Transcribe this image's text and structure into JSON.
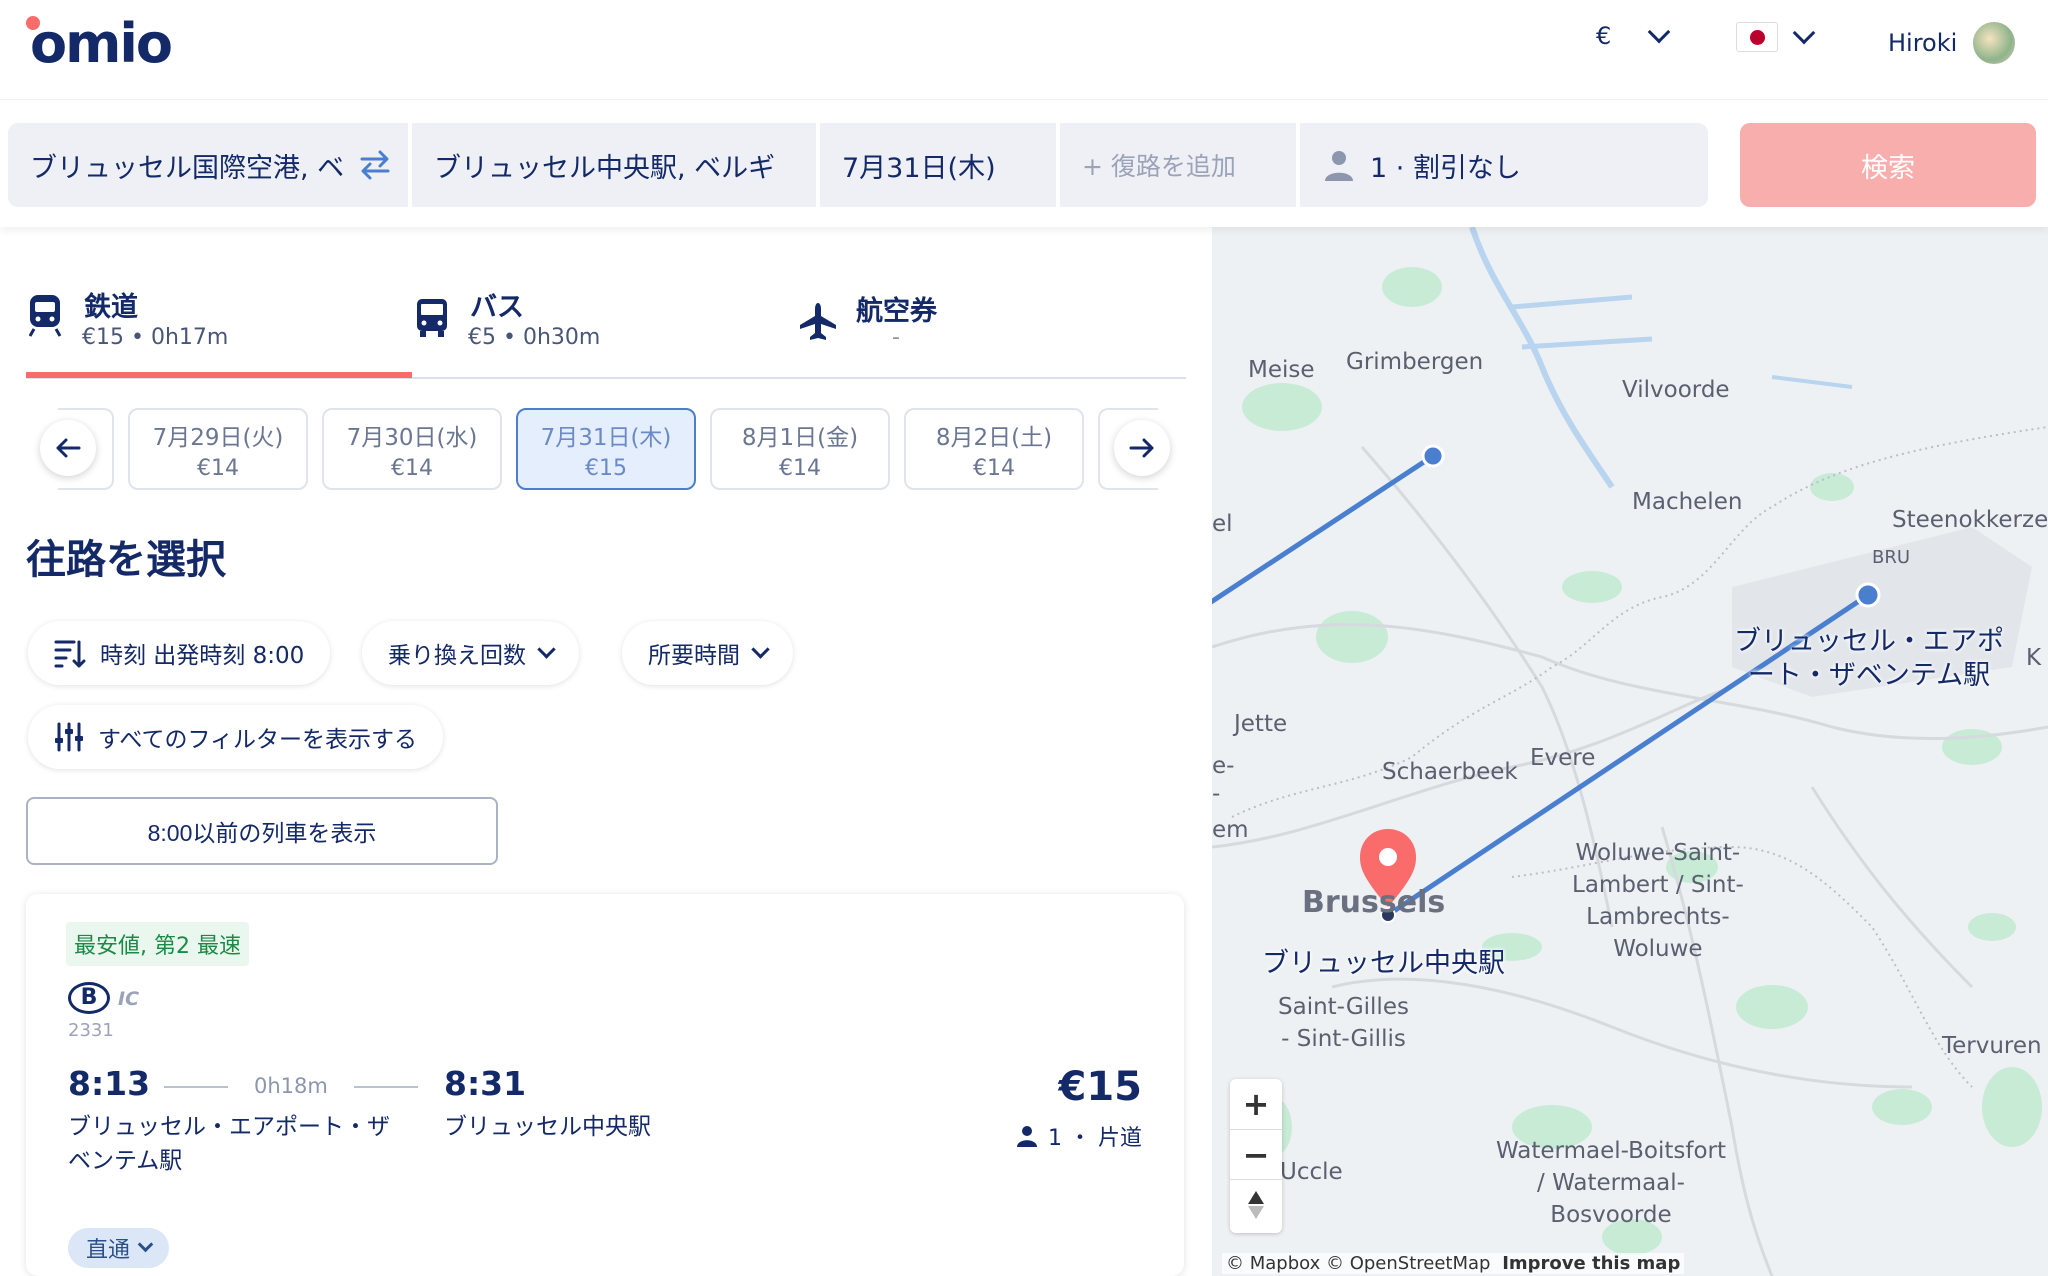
{
  "header": {
    "logo": "omio",
    "currency": "€",
    "user_name": "Hiroki"
  },
  "search": {
    "origin": "ブリュッセル国際空港, ベ",
    "destination": "ブリュッセル中央駅, ベルギ",
    "departure_date": "7月31日(木)",
    "return_placeholder": "+ 復路を追加",
    "passengers": "1 · 割引なし",
    "search_label": "検索"
  },
  "tabs": [
    {
      "title": "鉄道",
      "sub": "€15 • 0h17m"
    },
    {
      "title": "バス",
      "sub": "€5 • 0h30m"
    },
    {
      "title": "航空券",
      "sub": "-"
    }
  ],
  "dates": [
    {
      "date": "7月29日(火)",
      "price": "€14"
    },
    {
      "date": "7月30日(水)",
      "price": "€14"
    },
    {
      "date": "7月31日(木)",
      "price": "€15"
    },
    {
      "date": "8月1日(金)",
      "price": "€14"
    },
    {
      "date": "8月2日(土)",
      "price": "€14"
    }
  ],
  "section_title": "往路を選択",
  "filters": {
    "sort": "時刻 出発時刻 8:00",
    "transfers": "乗り換え回数",
    "duration": "所要時間",
    "all_filters": "すべてのフィルターを表示する",
    "earlier": "8:00以前の列車を表示"
  },
  "result": {
    "badge": "最安値, 第2 最速",
    "operator_logo": "B",
    "train_type": "IC",
    "train_number": "2331",
    "dep_time": "8:13",
    "duration": "0h18m",
    "arr_time": "8:31",
    "dep_station": "ブリュッセル・エアポート・ザベンテム駅",
    "arr_station": "ブリュッセル中央駅",
    "price": "€15",
    "pax": "1 ・ 片道",
    "direct": "直通"
  },
  "map": {
    "labels": {
      "meise": "Meise",
      "grimbergen": "Grimbergen",
      "vilvoorde": "Vilvoorde",
      "machelen": "Machelen",
      "steenokkerzeel": "Steenokkerze",
      "bru": "BRU",
      "el": "el",
      "jette": "Jette",
      "schaerbeek": "Schaerbeek",
      "evere": "Evere",
      "brussels": "Brussels",
      "woluwe": "Woluwe-Saint-\nLambert / Sint-\nLambrechts-\nWoluwe",
      "saint_gilles": "Saint-Gilles\n- Sint-Gillis",
      "tervuren": "Tervuren",
      "uccle": "Uccle",
      "watermael": "Watermael-Boitsfort\n/ Watermaal-\nBosvoorde",
      "airport_station": "ブリュッセル・エアポ\nート・ザベンテム駅",
      "central_station": "ブリュッセル中央駅",
      "k": "K",
      "e_dash": "e-",
      "dash": "-",
      "em": "em"
    },
    "attribution": "© Mapbox © OpenStreetMap",
    "improve": "Improve this map"
  },
  "colors": {
    "brand_navy": "#132968",
    "accent_red": "#fa6b6b",
    "route_blue": "#4a7fd0",
    "search_disabled": "#f9aeae"
  }
}
